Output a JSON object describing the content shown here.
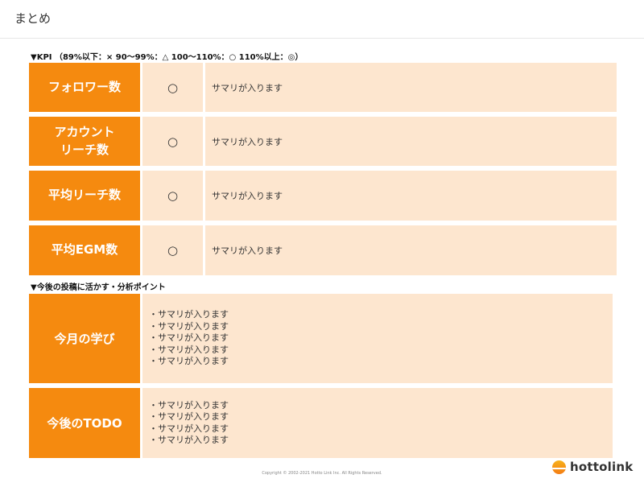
{
  "page_title": "まとめ",
  "kpi_section_label": "▼KPI （89%以下：× 90～99%：△ 100～110%：○ 110%以上：◎）",
  "kpi_rows": [
    {
      "name": "フォロワー数",
      "mark": "○",
      "summary": "サマリが入ります"
    },
    {
      "name": "アカウント\nリーチ数",
      "mark": "○",
      "summary": "サマリが入ります"
    },
    {
      "name": "平均リーチ数",
      "mark": "○",
      "summary": "サマリが入ります"
    },
    {
      "name": "平均EGM数",
      "mark": "○",
      "summary": "サマリが入ります"
    }
  ],
  "analysis_section_label": "▼今後の投稿に活かす・分析ポイント",
  "learnings": {
    "title": "今月の学び",
    "items": [
      "・サマリが入ります",
      "・サマリが入ります",
      "・サマリが入ります",
      "・サマリが入ります",
      "・サマリが入ります"
    ]
  },
  "todo": {
    "title": "今後のTODO",
    "items": [
      "・サマリが入ります",
      "・サマリが入ります",
      "・サマリが入ります",
      "・サマリが入ります"
    ]
  },
  "footer": {
    "copyright": "Copyright © 2002-2021 Hotto Link Inc. All Rights Reserved.",
    "logo_text": "hottolink"
  },
  "colors": {
    "accent": "#f58a0f",
    "cell_bg": "#fde6cf"
  }
}
